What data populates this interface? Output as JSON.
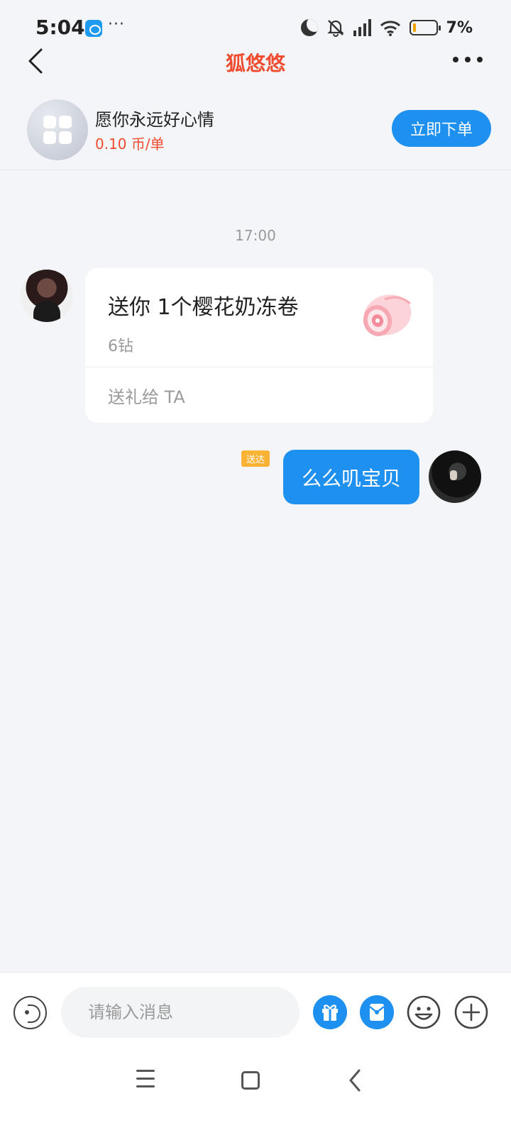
{
  "status_bar": {
    "time": "5:04",
    "app_icon": "bear-face-icon",
    "more_text": "···",
    "battery_percent": "7%",
    "battery_level": 0.07,
    "icons": [
      "moon-icon",
      "bell-off-icon",
      "signal-icon",
      "wifi-icon",
      "battery-icon"
    ]
  },
  "header": {
    "title": "狐悠悠",
    "back_icon": "chevron-left-icon",
    "more_icon": "more-horizontal-icon"
  },
  "service": {
    "name": "愿你永远好心情",
    "price": "0.10 币/单",
    "order_button": "立即下单",
    "icon": "app-grid-icon"
  },
  "chat": {
    "timestamp": "17:00",
    "messages": [
      {
        "type": "gift",
        "side": "left",
        "title": "送你 1个樱花奶冻卷",
        "price": "6钻",
        "action": "送礼给 TA",
        "gift_icon": "sakura-roll-cake-icon"
      },
      {
        "type": "text",
        "side": "right",
        "text": "么么叽宝贝",
        "status": "送达"
      }
    ]
  },
  "input_bar": {
    "placeholder": "请输入消息",
    "value": "",
    "icons": [
      "voice-icon",
      "gift-icon",
      "red-packet-icon",
      "emoji-icon",
      "plus-icon"
    ]
  },
  "colors": {
    "accent_blue": "#1e90f0",
    "title_red": "#f04b2e",
    "badge_yellow": "#f9b233",
    "background": "#f3f5f8"
  }
}
